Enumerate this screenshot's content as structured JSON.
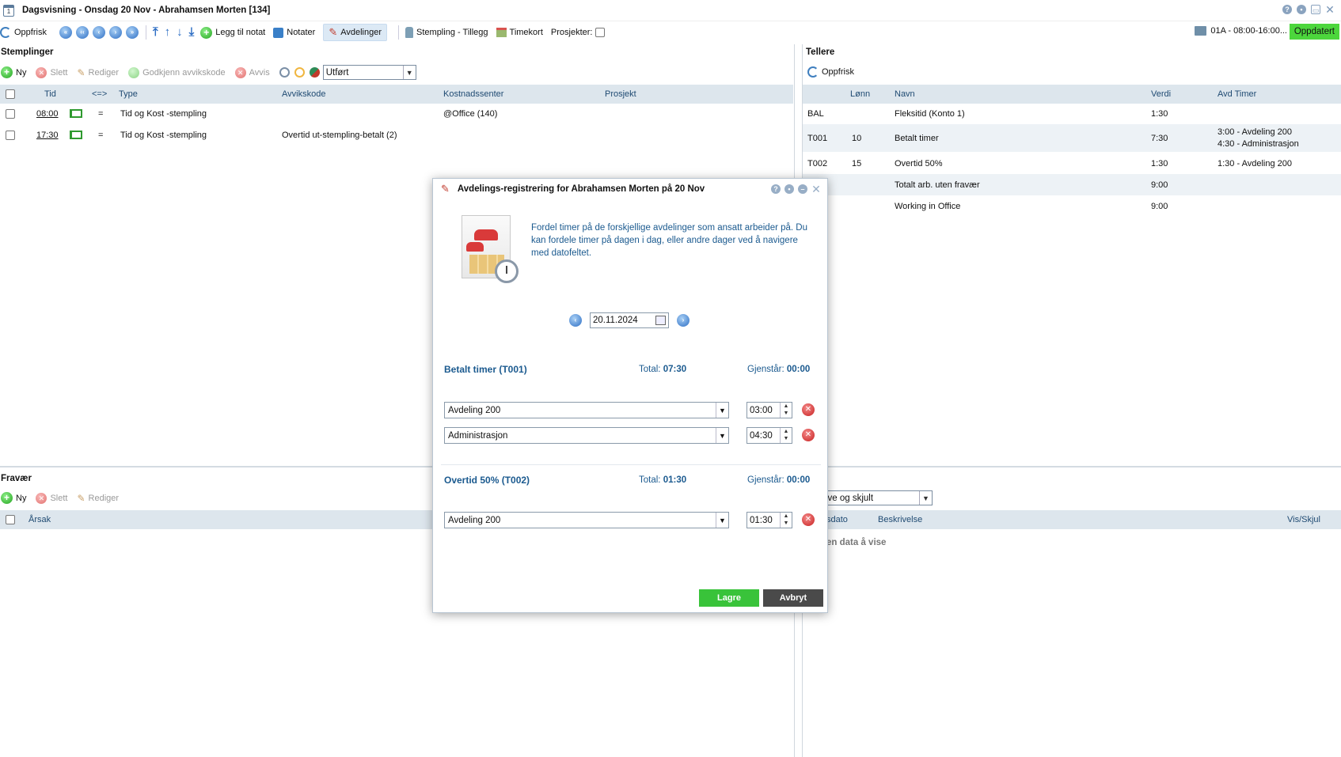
{
  "window": {
    "title": "Dagsvisning - Onsdag 20 Nov - Abrahamsen Morten [134]"
  },
  "toolbar": {
    "refresh": "Oppfrisk",
    "add_note": "Legg til notat",
    "notes": "Notater",
    "departments": "Avdelinger",
    "stamping_extra": "Stempling - Tillegg",
    "timecard": "Timekort",
    "projects_label": "Prosjekter:",
    "shift": "01A - 08:00-16:00...",
    "updated": "Oppdatert"
  },
  "stamps": {
    "heading": "Stemplinger",
    "new": "Ny",
    "delete": "Slett",
    "edit": "Rediger",
    "approve": "Godkjenn avvikskode",
    "reject": "Avvis",
    "status_select": "Utført",
    "columns": {
      "time": "Tid",
      "dir": "<=>",
      "type": "Type",
      "code": "Avvikskode",
      "cost": "Kostnadssenter",
      "project": "Prosjekt"
    },
    "rows": [
      {
        "time": "08:00",
        "dir": "=",
        "type": "Tid og Kost -stempling",
        "code": "",
        "cost": "@Office (140)",
        "project": ""
      },
      {
        "time": "17:30",
        "dir": "=",
        "type": "Tid og Kost -stempling",
        "code": "Overtid ut-stempling-betalt (2)",
        "cost": "",
        "project": ""
      }
    ]
  },
  "counters": {
    "heading": "Tellere",
    "refresh": "Oppfrisk",
    "columns": {
      "salary": "Lønn",
      "name": "Navn",
      "value": "Verdi",
      "dept_hours": "Avd Timer"
    },
    "rows": [
      {
        "code": "BAL",
        "salary": "",
        "name": "Fleksitid (Konto 1)",
        "value": "1:30",
        "dept1": "",
        "dept2": ""
      },
      {
        "code": "T001",
        "salary": "10",
        "name": "Betalt timer",
        "value": "7:30",
        "dept1": "3:00 - Avdeling 200",
        "dept2": "4:30 - Administrasjon"
      },
      {
        "code": "T002",
        "salary": "15",
        "name": "Overtid 50%",
        "value": "1:30",
        "dept1": "1:30 - Avdeling 200",
        "dept2": ""
      },
      {
        "code": "",
        "salary": "",
        "name": "Totalt arb. uten fravær",
        "value": "9:00",
        "dept1": "",
        "dept2": ""
      },
      {
        "code": "",
        "salary": "",
        "name": "Working in Office",
        "value": "9:00",
        "dept1": "",
        "dept2": ""
      }
    ]
  },
  "absence": {
    "heading": "Fravær",
    "new": "Ny",
    "delete": "Slett",
    "edit": "Rediger",
    "columns": {
      "reason": "Årsak"
    }
  },
  "notes_panel": {
    "heading_partial": "t",
    "filter_select": "ktive og skjult",
    "columns": {
      "date": "sdato",
      "desc": "Beskrivelse",
      "visibility": "Vis/Skjul"
    },
    "empty": "en data å vise"
  },
  "dialog": {
    "title": "Avdelings-registrering for Abrahamsen Morten på 20 Nov",
    "description": "Fordel timer på de forskjellige avdelinger som ansatt arbeider på. Du kan fordele timer på dagen i dag, eller andre dager ved å navigere med datofeltet.",
    "date": "20.11.2024",
    "sections": [
      {
        "title": "Betalt timer (T001)",
        "total_label": "Total:",
        "total": "07:30",
        "remaining_label": "Gjenstår:",
        "remaining": "00:00",
        "rows": [
          {
            "department": "Avdeling 200",
            "hours": "03:00"
          },
          {
            "department": "Administrasjon",
            "hours": "04:30"
          }
        ]
      },
      {
        "title": "Overtid 50% (T002)",
        "total_label": "Total:",
        "total": "01:30",
        "remaining_label": "Gjenstår:",
        "remaining": "00:00",
        "rows": [
          {
            "department": "Avdeling 200",
            "hours": "01:30"
          }
        ]
      }
    ],
    "save": "Lagre",
    "cancel": "Avbryt"
  }
}
